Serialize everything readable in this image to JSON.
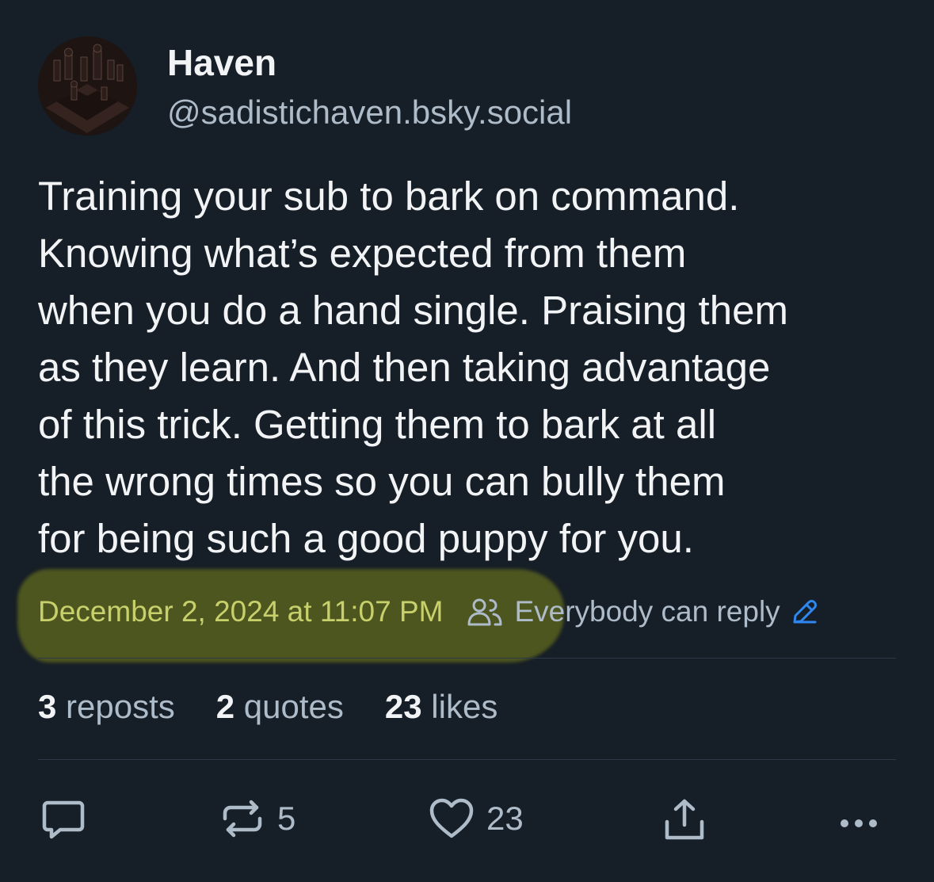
{
  "author": {
    "display_name": "Haven",
    "handle": "@sadistichaven.bsky.social",
    "avatar_icon": "chess-board-avatar"
  },
  "post": {
    "lines": [
      "Training your sub to bark on command.",
      "Knowing what’s expected from them",
      "when you do a hand single. Praising them",
      "as they learn. And then taking advantage",
      "of this trick. Getting them to bark at all",
      "the wrong times so you can bully them",
      "for being such a good puppy for you."
    ]
  },
  "meta": {
    "timestamp": "December 2, 2024 at 11:07 PM",
    "reply_setting": "Everybody can reply",
    "reply_icon": "people-icon",
    "edit_icon": "pencil-icon",
    "highlight_color": "#a0aa14"
  },
  "stats": {
    "reposts_count": "3",
    "reposts_label": "reposts",
    "quotes_count": "2",
    "quotes_label": "quotes",
    "likes_count": "23",
    "likes_label": "likes"
  },
  "actions": {
    "reply_icon": "comment-icon",
    "repost_icon": "repost-icon",
    "repost_count": "5",
    "like_icon": "heart-icon",
    "like_count": "23",
    "share_icon": "share-icon",
    "more_icon": "more-icon"
  },
  "colors": {
    "background": "#161e27",
    "text": "#f1f3f5",
    "muted": "#aebbc9",
    "accent": "#2f87f0"
  }
}
